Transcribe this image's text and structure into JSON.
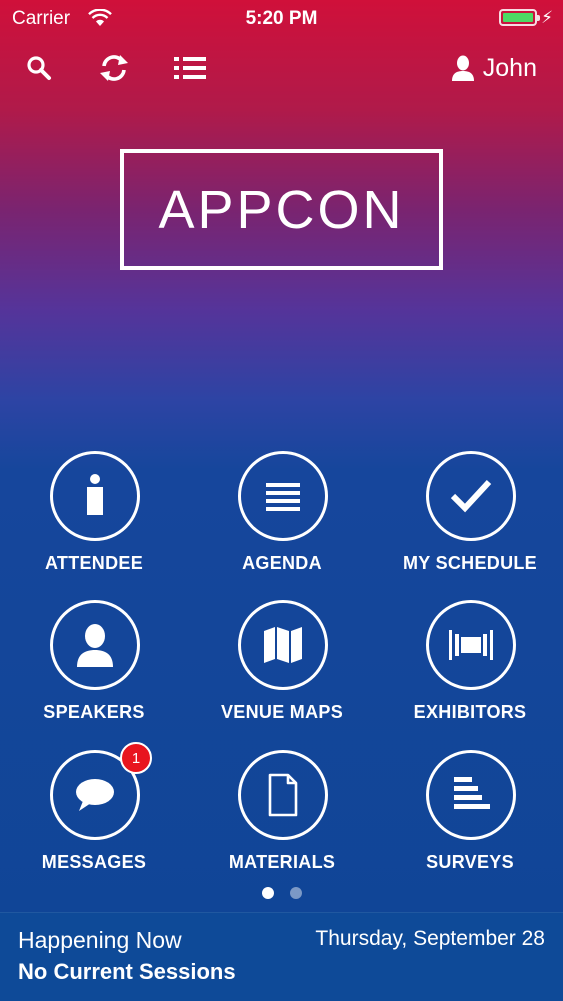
{
  "status_bar": {
    "carrier": "Carrier",
    "time": "5:20 PM",
    "battery_level": 1.0
  },
  "nav": {
    "user_name": "John",
    "icons": [
      "search-icon",
      "refresh-icon",
      "list-icon",
      "user-icon"
    ]
  },
  "logo": {
    "text": "APPCON"
  },
  "menu": [
    {
      "label": "ATTENDEE",
      "icon": "info-icon"
    },
    {
      "label": "AGENDA",
      "icon": "agenda-lines-icon"
    },
    {
      "label": "MY SCHEDULE",
      "icon": "checkmark-icon"
    },
    {
      "label": "SPEAKERS",
      "icon": "person-icon"
    },
    {
      "label": "VENUE MAPS",
      "icon": "map-icon"
    },
    {
      "label": "EXHIBITORS",
      "icon": "banner-icon"
    },
    {
      "label": "MESSAGES",
      "icon": "chat-bubble-icon",
      "badge": "1"
    },
    {
      "label": "MATERIALS",
      "icon": "document-icon"
    },
    {
      "label": "SURVEYS",
      "icon": "bars-icon"
    }
  ],
  "pager": {
    "pages": 2,
    "current": 1
  },
  "bottom": {
    "title": "Happening Now",
    "date": "Thursday, September 28",
    "sessions": "No Current Sessions"
  },
  "colors": {
    "top": "#d0103a",
    "middle": "#55349a",
    "bottom": "#0f4596",
    "badge": "#e8151f",
    "battery": "#4cd964"
  }
}
